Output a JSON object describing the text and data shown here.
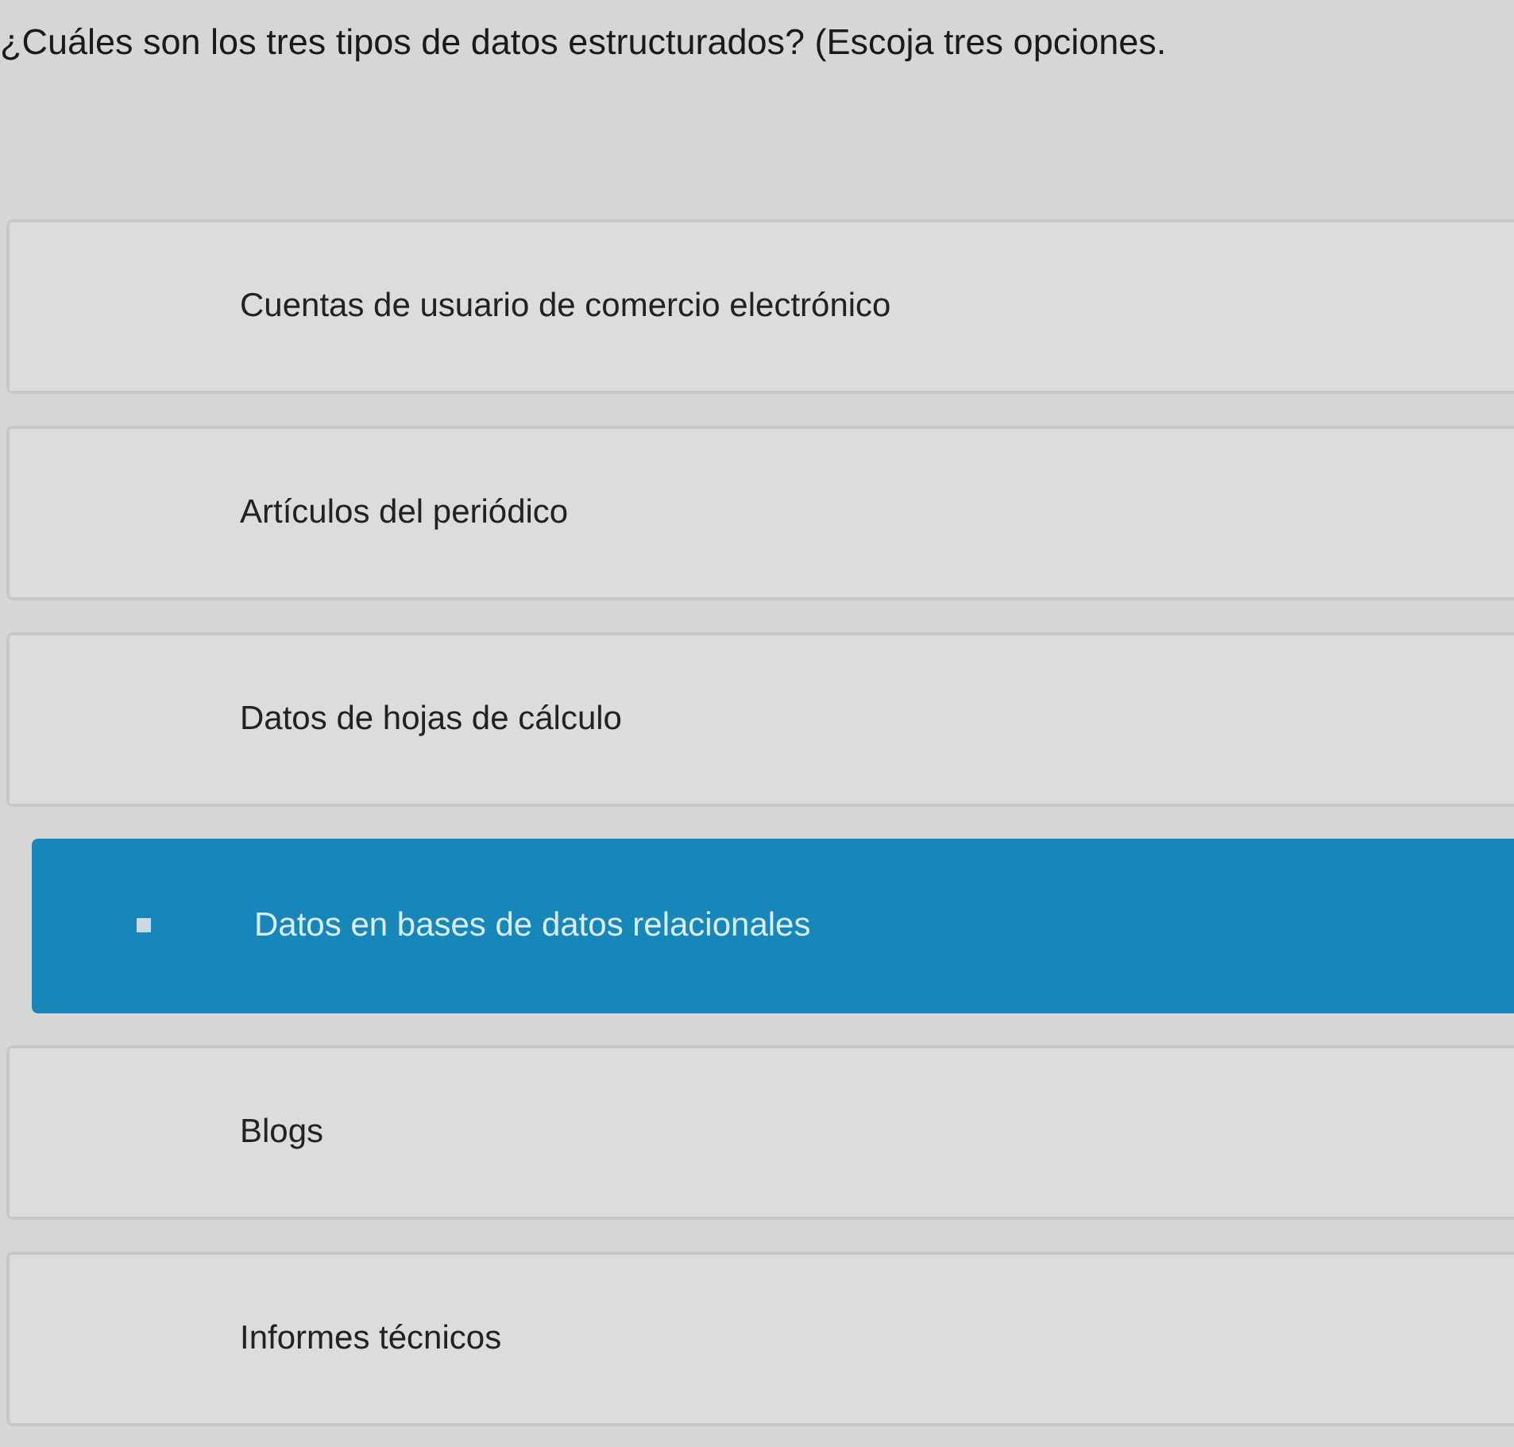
{
  "question": "¿Cuáles son los tres tipos de datos estructurados? (Escoja tres opciones.",
  "options": [
    {
      "label": "Cuentas de usuario de comercio electrónico",
      "selected": false
    },
    {
      "label": "Artículos del periódico",
      "selected": false
    },
    {
      "label": "Datos de hojas de cálculo",
      "selected": false
    },
    {
      "label": "Datos en bases de datos relacionales",
      "selected": true
    },
    {
      "label": "Blogs",
      "selected": false
    },
    {
      "label": "Informes técnicos",
      "selected": false
    }
  ]
}
